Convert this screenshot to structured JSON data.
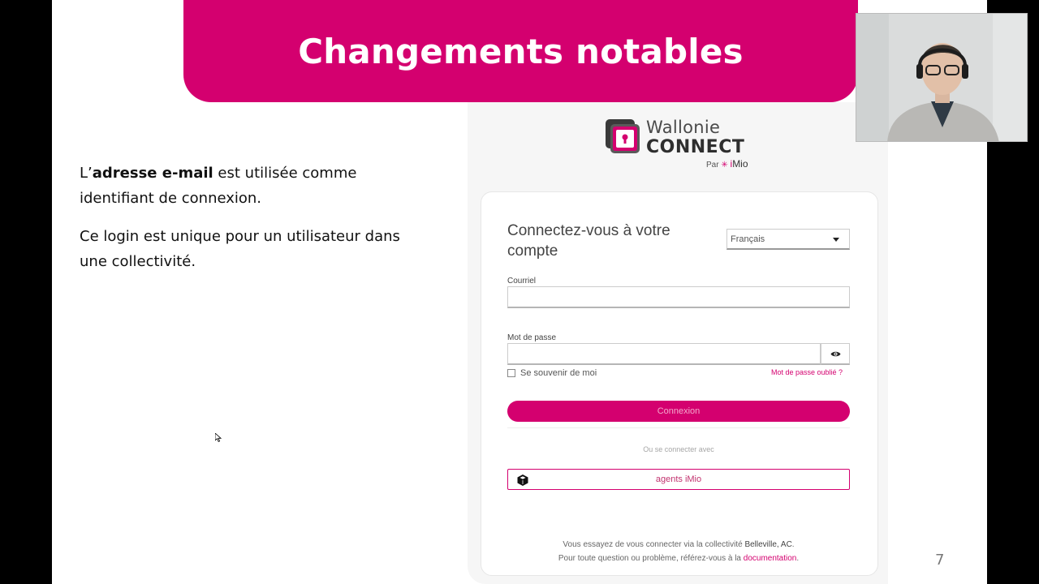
{
  "slide": {
    "title": "Changements notables",
    "paragraph1": {
      "prefix": "L’",
      "bold": "adresse e-mail",
      "suffix": " est utilisée comme identifiant de connexion."
    },
    "paragraph2": "Ce login est unique pour un utilisateur dans une collectivité.",
    "page_number": "7"
  },
  "login": {
    "logo": {
      "line1": "Wallonie",
      "line2": "CONNECT",
      "par": "Par",
      "brand_i": "i",
      "brand_rest": "Mio"
    },
    "title": "Connectez-vous à votre compte",
    "language": "Français",
    "email_label": "Courriel",
    "email_value": "",
    "password_label": "Mot de passe",
    "password_value": "",
    "remember_label": "Se souvenir de moi",
    "forgot_link": "Mot de passe oublié ?",
    "submit_label": "Connexion",
    "or_text": "Ou se connecter avec",
    "agents_label": "agents iMio",
    "footer_line1_prefix": "Vous essayez de vous connecter via la collectivité ",
    "footer_line1_name": "Belleville, AC",
    "footer_line1_suffix": ".",
    "footer_line2_prefix": "Pour toute question ou problème, référez-vous à la ",
    "footer_line2_link": "documentation",
    "footer_line2_suffix": "."
  },
  "icons": {
    "logo_mark": "lock-in-square-icon",
    "password_toggle": "eye-icon",
    "agents": "cube-icon",
    "dropdown": "caret-down-icon"
  },
  "colors": {
    "brand": "#d4006f",
    "background": "#000000",
    "slide": "#ffffff"
  }
}
